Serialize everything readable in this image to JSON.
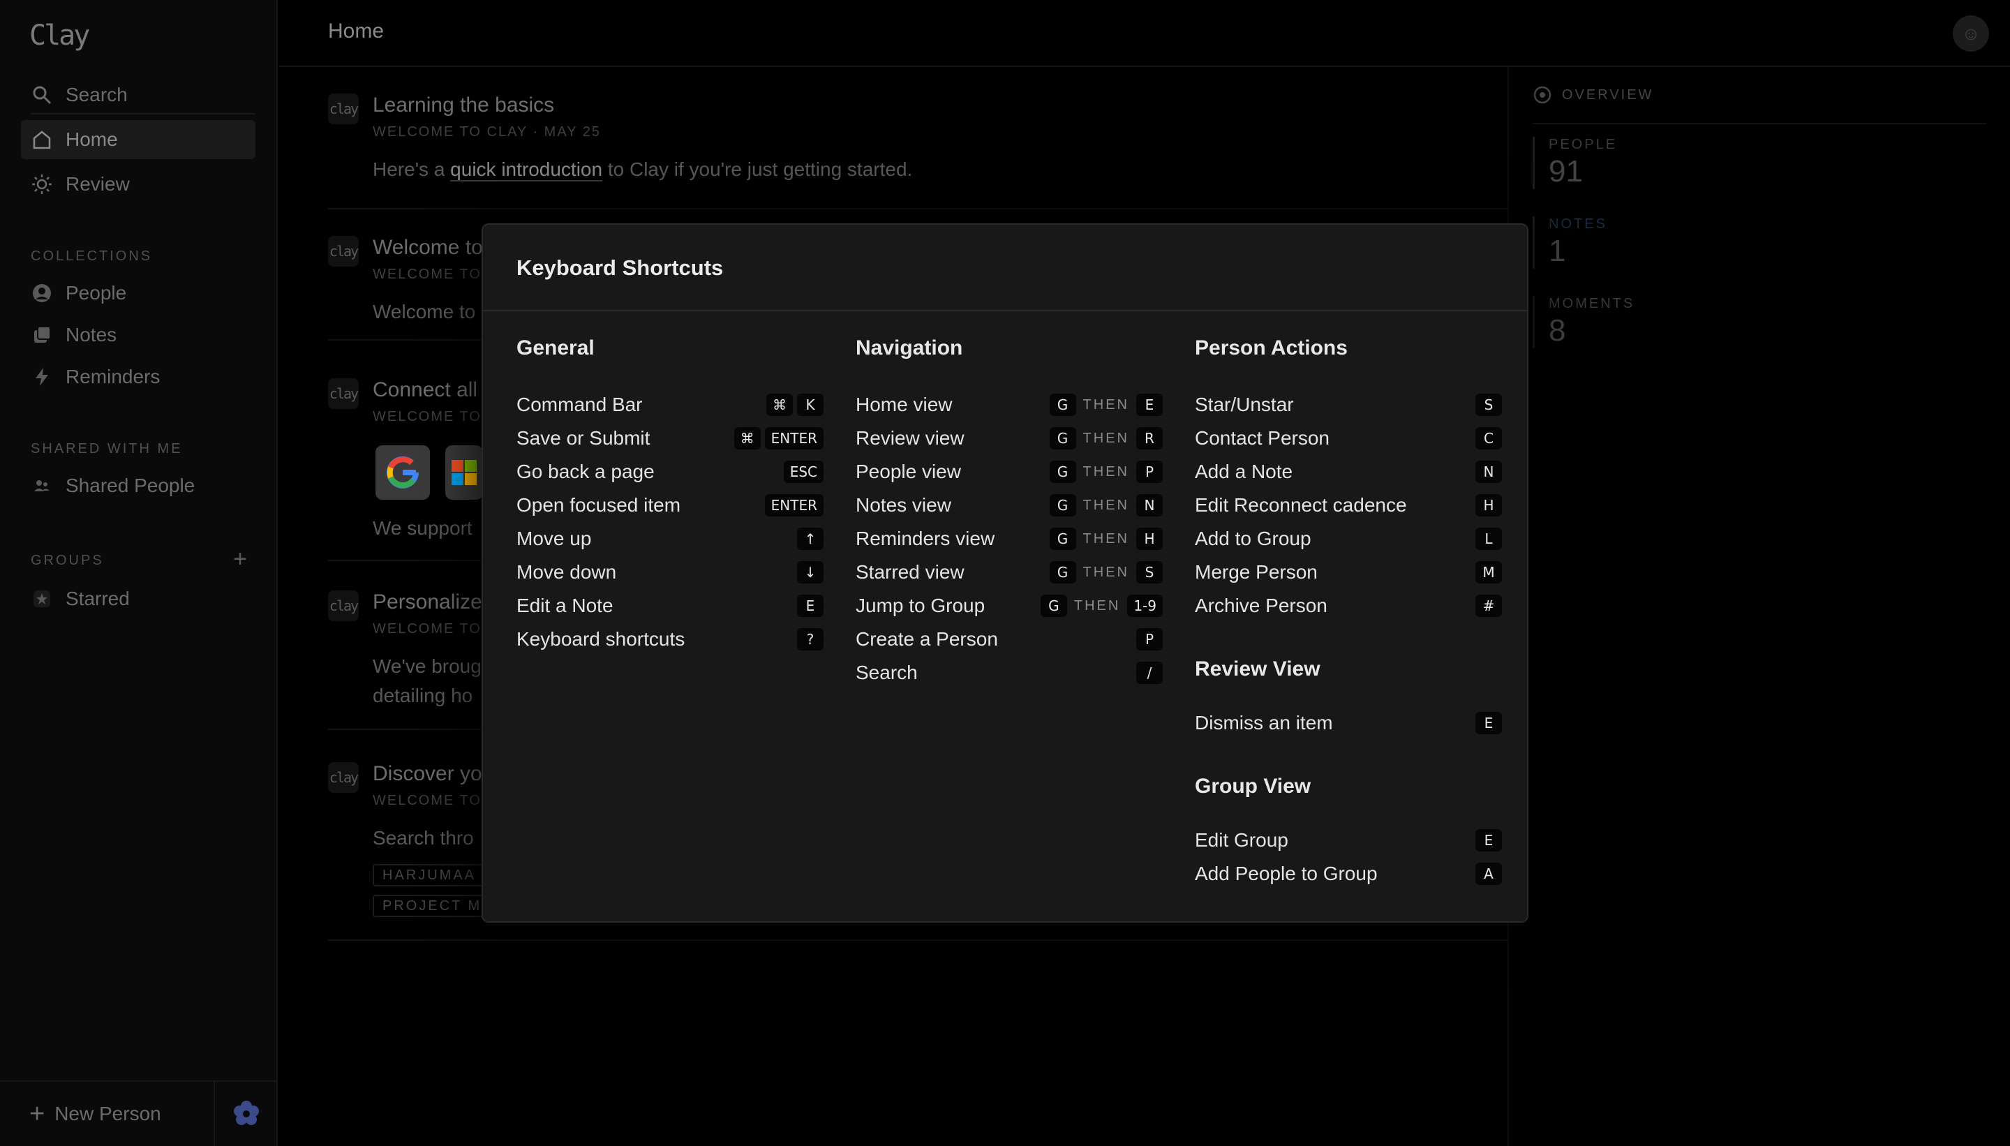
{
  "app": {
    "logo": "Clay"
  },
  "sidebar": {
    "search": "Search",
    "home": "Home",
    "review": "Review",
    "collections_label": "COLLECTIONS",
    "people": "People",
    "notes": "Notes",
    "reminders": "Reminders",
    "shared_label": "SHARED WITH ME",
    "shared_people": "Shared People",
    "groups_label": "GROUPS",
    "starred": "Starred",
    "new_person": "New Person"
  },
  "header": {
    "title": "Home"
  },
  "feed": [
    {
      "title": "Learning the basics",
      "meta": "WELCOME TO CLAY · MAY 25",
      "body_before": "Here's a ",
      "body_link": "quick introduction",
      "body_after": " to Clay if you're just getting started."
    },
    {
      "title": "Welcome to",
      "meta": "WELCOME TO",
      "body": "Welcome to"
    },
    {
      "title": "Connect all",
      "meta": "WELCOME TO",
      "body": "We support"
    },
    {
      "title": "Personalize",
      "meta": "WELCOME TO",
      "body": "We've broug",
      "body2": "detailing ho"
    },
    {
      "title": "Discover yo",
      "meta": "WELCOME TO",
      "body": "Search thro",
      "tags": [
        "HARJUMAA",
        "PROJECT MA"
      ]
    }
  ],
  "overview": {
    "label": "OVERVIEW",
    "stats": [
      {
        "label": "PEOPLE",
        "value": "91"
      },
      {
        "label": "NOTES",
        "value": "1"
      },
      {
        "label": "MOMENTS",
        "value": "8"
      }
    ]
  },
  "modal": {
    "title": "Keyboard Shortcuts",
    "then": "THEN",
    "general": {
      "heading": "General",
      "items": [
        {
          "label": "Command Bar",
          "keys": [
            "⌘",
            "K"
          ]
        },
        {
          "label": "Save or Submit",
          "keys": [
            "⌘",
            "ENTER"
          ]
        },
        {
          "label": "Go back a page",
          "keys": [
            "ESC"
          ]
        },
        {
          "label": "Open focused item",
          "keys": [
            "ENTER"
          ]
        },
        {
          "label": "Move up",
          "keys": [
            "↑"
          ]
        },
        {
          "label": "Move down",
          "keys": [
            "↓"
          ]
        },
        {
          "label": "Edit a Note",
          "keys": [
            "E"
          ]
        },
        {
          "label": "Keyboard shortcuts",
          "keys": [
            "?"
          ]
        }
      ]
    },
    "navigation": {
      "heading": "Navigation",
      "items": [
        {
          "label": "Home view",
          "keys": [
            "G",
            "E"
          ]
        },
        {
          "label": "Review view",
          "keys": [
            "G",
            "R"
          ]
        },
        {
          "label": "People view",
          "keys": [
            "G",
            "P"
          ]
        },
        {
          "label": "Notes view",
          "keys": [
            "G",
            "N"
          ]
        },
        {
          "label": "Reminders view",
          "keys": [
            "G",
            "H"
          ]
        },
        {
          "label": "Starred view",
          "keys": [
            "G",
            "S"
          ]
        },
        {
          "label": "Jump to Group",
          "keys": [
            "G",
            "1-9"
          ]
        },
        {
          "label": "Create a Person",
          "keys": [
            "P"
          ]
        },
        {
          "label": "Search",
          "keys": [
            "/"
          ]
        }
      ]
    },
    "person_actions": {
      "heading": "Person Actions",
      "items": [
        {
          "label": "Star/Unstar",
          "keys": [
            "S"
          ]
        },
        {
          "label": "Contact Person",
          "keys": [
            "C"
          ]
        },
        {
          "label": "Add a Note",
          "keys": [
            "N"
          ]
        },
        {
          "label": "Edit Reconnect cadence",
          "keys": [
            "H"
          ]
        },
        {
          "label": "Add to Group",
          "keys": [
            "L"
          ]
        },
        {
          "label": "Merge Person",
          "keys": [
            "M"
          ]
        },
        {
          "label": "Archive Person",
          "keys": [
            "#"
          ]
        }
      ]
    },
    "review_view": {
      "heading": "Review View",
      "items": [
        {
          "label": "Dismiss an item",
          "keys": [
            "E"
          ]
        }
      ]
    },
    "group_view": {
      "heading": "Group View",
      "items": [
        {
          "label": "Edit Group",
          "keys": [
            "E"
          ]
        },
        {
          "label": "Add People to Group",
          "keys": [
            "A"
          ]
        }
      ]
    }
  }
}
